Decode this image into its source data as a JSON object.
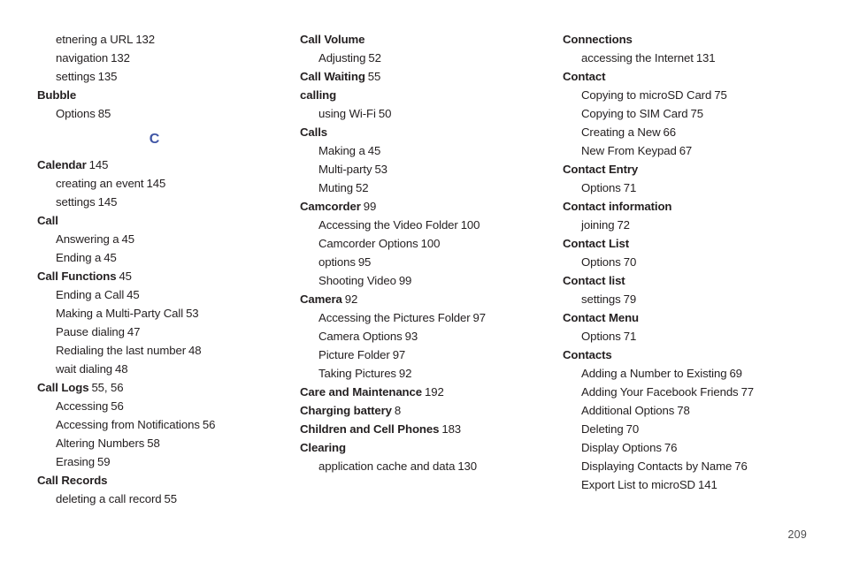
{
  "document": {
    "type": "index-page",
    "page_number": "209",
    "accent_color": "#3f55a5",
    "text_color": "#231f20",
    "background_color": "#ffffff"
  },
  "columns": [
    {
      "id": "column-1",
      "blocks": [
        {
          "kind": "entry",
          "level": "sub",
          "term": "etnering a URL",
          "pages": "132"
        },
        {
          "kind": "entry",
          "level": "sub",
          "term": "navigation",
          "pages": "132"
        },
        {
          "kind": "entry",
          "level": "sub",
          "term": "settings",
          "pages": "135"
        },
        {
          "kind": "entry",
          "level": "main",
          "term": "Bubble",
          "pages": ""
        },
        {
          "kind": "entry",
          "level": "sub",
          "term": "Options",
          "pages": "85"
        },
        {
          "kind": "letter",
          "letter": "C"
        },
        {
          "kind": "entry",
          "level": "main",
          "term": "Calendar",
          "pages": "145"
        },
        {
          "kind": "entry",
          "level": "sub",
          "term": "creating an event",
          "pages": "145"
        },
        {
          "kind": "entry",
          "level": "sub",
          "term": "settings",
          "pages": "145"
        },
        {
          "kind": "entry",
          "level": "main",
          "term": "Call",
          "pages": ""
        },
        {
          "kind": "entry",
          "level": "sub",
          "term": "Answering a",
          "pages": "45"
        },
        {
          "kind": "entry",
          "level": "sub",
          "term": "Ending a",
          "pages": "45"
        },
        {
          "kind": "entry",
          "level": "main",
          "term": "Call Functions",
          "pages": "45"
        },
        {
          "kind": "entry",
          "level": "sub",
          "term": "Ending a Call",
          "pages": "45"
        },
        {
          "kind": "entry",
          "level": "sub",
          "term": "Making a Multi-Party Call",
          "pages": "53"
        },
        {
          "kind": "entry",
          "level": "sub",
          "term": "Pause dialing",
          "pages": "47"
        },
        {
          "kind": "entry",
          "level": "sub",
          "term": "Redialing the last number",
          "pages": "48"
        },
        {
          "kind": "entry",
          "level": "sub",
          "term": "wait dialing",
          "pages": "48"
        },
        {
          "kind": "entry",
          "level": "main",
          "term": "Call Logs",
          "pages": "55, 56"
        },
        {
          "kind": "entry",
          "level": "sub",
          "term": "Accessing",
          "pages": "56"
        },
        {
          "kind": "entry",
          "level": "sub",
          "term": "Accessing from Notifications",
          "pages": "56"
        },
        {
          "kind": "entry",
          "level": "sub",
          "term": "Altering Numbers",
          "pages": "58"
        },
        {
          "kind": "entry",
          "level": "sub",
          "term": "Erasing",
          "pages": "59"
        },
        {
          "kind": "entry",
          "level": "main",
          "term": "Call Records",
          "pages": ""
        },
        {
          "kind": "entry",
          "level": "sub",
          "term": "deleting a call record",
          "pages": "55"
        }
      ]
    },
    {
      "id": "column-2",
      "blocks": [
        {
          "kind": "entry",
          "level": "main",
          "term": "Call Volume",
          "pages": ""
        },
        {
          "kind": "entry",
          "level": "sub",
          "term": "Adjusting",
          "pages": "52"
        },
        {
          "kind": "entry",
          "level": "main",
          "term": "Call Waiting",
          "pages": "55"
        },
        {
          "kind": "entry",
          "level": "main",
          "term": "calling",
          "pages": ""
        },
        {
          "kind": "entry",
          "level": "sub",
          "term": "using Wi-Fi",
          "pages": "50"
        },
        {
          "kind": "entry",
          "level": "main",
          "term": "Calls",
          "pages": ""
        },
        {
          "kind": "entry",
          "level": "sub",
          "term": "Making a",
          "pages": "45"
        },
        {
          "kind": "entry",
          "level": "sub",
          "term": "Multi-party",
          "pages": "53"
        },
        {
          "kind": "entry",
          "level": "sub",
          "term": "Muting",
          "pages": "52"
        },
        {
          "kind": "entry",
          "level": "main",
          "term": "Camcorder",
          "pages": "99"
        },
        {
          "kind": "entry",
          "level": "sub",
          "term": "Accessing the Video Folder",
          "pages": "100"
        },
        {
          "kind": "entry",
          "level": "sub",
          "term": "Camcorder Options",
          "pages": "100"
        },
        {
          "kind": "entry",
          "level": "sub",
          "term": "options",
          "pages": "95"
        },
        {
          "kind": "entry",
          "level": "sub",
          "term": "Shooting Video",
          "pages": "99"
        },
        {
          "kind": "entry",
          "level": "main",
          "term": "Camera",
          "pages": "92"
        },
        {
          "kind": "entry",
          "level": "sub",
          "term": "Accessing the Pictures Folder",
          "pages": "97"
        },
        {
          "kind": "entry",
          "level": "sub",
          "term": "Camera Options",
          "pages": "93"
        },
        {
          "kind": "entry",
          "level": "sub",
          "term": "Picture Folder",
          "pages": "97"
        },
        {
          "kind": "entry",
          "level": "sub",
          "term": "Taking Pictures",
          "pages": "92"
        },
        {
          "kind": "entry",
          "level": "main",
          "term": "Care and Maintenance",
          "pages": "192"
        },
        {
          "kind": "entry",
          "level": "main",
          "term": "Charging battery",
          "pages": "8"
        },
        {
          "kind": "entry",
          "level": "main",
          "term": "Children and Cell Phones",
          "pages": "183"
        },
        {
          "kind": "entry",
          "level": "main",
          "term": "Clearing",
          "pages": ""
        },
        {
          "kind": "entry",
          "level": "sub",
          "term": "application cache and data",
          "pages": "130"
        }
      ]
    },
    {
      "id": "column-3",
      "blocks": [
        {
          "kind": "entry",
          "level": "main",
          "term": "Connections",
          "pages": ""
        },
        {
          "kind": "entry",
          "level": "sub",
          "term": "accessing the Internet",
          "pages": "131"
        },
        {
          "kind": "entry",
          "level": "main",
          "term": "Contact",
          "pages": ""
        },
        {
          "kind": "entry",
          "level": "sub",
          "term": "Copying to microSD Card",
          "pages": "75"
        },
        {
          "kind": "entry",
          "level": "sub",
          "term": "Copying to SIM Card",
          "pages": "75"
        },
        {
          "kind": "entry",
          "level": "sub",
          "term": "Creating a New",
          "pages": "66"
        },
        {
          "kind": "entry",
          "level": "sub",
          "term": "New From Keypad",
          "pages": "67"
        },
        {
          "kind": "entry",
          "level": "main",
          "term": "Contact Entry",
          "pages": ""
        },
        {
          "kind": "entry",
          "level": "sub",
          "term": "Options",
          "pages": "71"
        },
        {
          "kind": "entry",
          "level": "main",
          "term": "Contact information",
          "pages": ""
        },
        {
          "kind": "entry",
          "level": "sub",
          "term": "joining",
          "pages": "72"
        },
        {
          "kind": "entry",
          "level": "main",
          "term": "Contact List",
          "pages": ""
        },
        {
          "kind": "entry",
          "level": "sub",
          "term": "Options",
          "pages": "70"
        },
        {
          "kind": "entry",
          "level": "main",
          "term": "Contact list",
          "pages": ""
        },
        {
          "kind": "entry",
          "level": "sub",
          "term": "settings",
          "pages": "79"
        },
        {
          "kind": "entry",
          "level": "main",
          "term": "Contact Menu",
          "pages": ""
        },
        {
          "kind": "entry",
          "level": "sub",
          "term": "Options",
          "pages": "71"
        },
        {
          "kind": "entry",
          "level": "main",
          "term": "Contacts",
          "pages": ""
        },
        {
          "kind": "entry",
          "level": "sub",
          "term": "Adding a Number to Existing",
          "pages": "69"
        },
        {
          "kind": "entry",
          "level": "sub",
          "term": "Adding Your Facebook Friends",
          "pages": "77"
        },
        {
          "kind": "entry",
          "level": "sub",
          "term": "Additional Options",
          "pages": "78"
        },
        {
          "kind": "entry",
          "level": "sub",
          "term": "Deleting",
          "pages": "70"
        },
        {
          "kind": "entry",
          "level": "sub",
          "term": "Display Options",
          "pages": "76"
        },
        {
          "kind": "entry",
          "level": "sub",
          "term": "Displaying Contacts by Name",
          "pages": "76"
        },
        {
          "kind": "entry",
          "level": "sub",
          "term": "Export List to microSD",
          "pages": "141"
        }
      ]
    }
  ]
}
